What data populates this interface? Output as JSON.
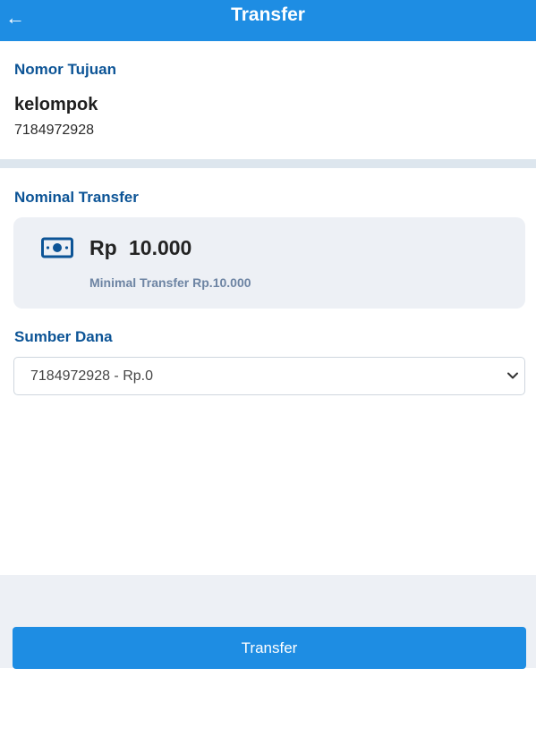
{
  "header": {
    "title": "Transfer",
    "back_icon": "arrow-left-icon"
  },
  "destination": {
    "label": "Nomor Tujuan",
    "name": "kelompok",
    "account_number": "7184972928"
  },
  "nominal": {
    "label": "Nominal Transfer",
    "icon": "money-icon",
    "currency": "Rp",
    "amount": "10.000",
    "minimum_note": "Minimal Transfer Rp.10.000"
  },
  "source": {
    "label": "Sumber Dana",
    "selected": "7184972928 - Rp.0"
  },
  "actions": {
    "transfer_label": "Transfer"
  },
  "colors": {
    "primary": "#1e8de3",
    "label_blue": "#0c5496",
    "card_bg": "#edf0f5",
    "divider": "#dde6ee"
  }
}
